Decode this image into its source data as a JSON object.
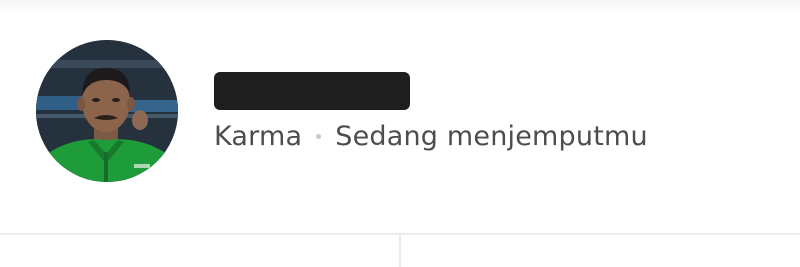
{
  "driver": {
    "name": "",
    "rating_label": "Karma",
    "status": "Sedang menjemputmu"
  },
  "colors": {
    "jacket": "#1f9c3a",
    "text": "#4d4d4d",
    "divider": "#ececec"
  },
  "icons": {
    "separator": "dot"
  }
}
